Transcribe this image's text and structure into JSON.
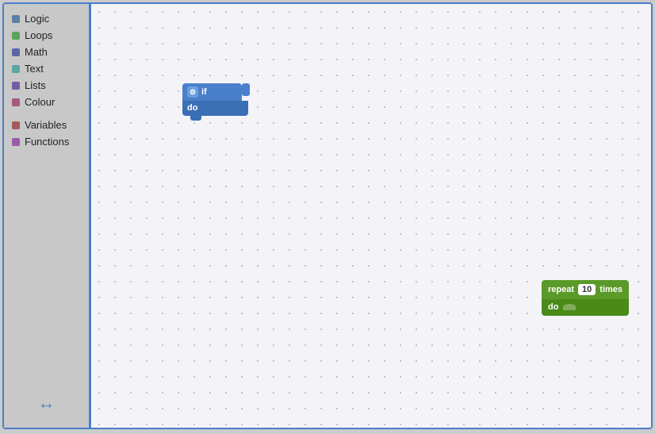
{
  "sidebar": {
    "items": [
      {
        "id": "logic",
        "label": "Logic",
        "color": "#5b80a5"
      },
      {
        "id": "loops",
        "label": "Loops",
        "color": "#5ba55b"
      },
      {
        "id": "math",
        "label": "Math",
        "color": "#5b67a5"
      },
      {
        "id": "text",
        "label": "Text",
        "color": "#5ba5a5"
      },
      {
        "id": "lists",
        "label": "Lists",
        "color": "#745ba5"
      },
      {
        "id": "colour",
        "label": "Colour",
        "color": "#a55b80"
      },
      {
        "id": "variables",
        "label": "Variables",
        "color": "#a55b5b"
      },
      {
        "id": "functions",
        "label": "Functions",
        "color": "#995ba5"
      }
    ],
    "resize_icon": "↔"
  },
  "if_block": {
    "label_if": "if",
    "label_do": "do",
    "gear_symbol": "⚙"
  },
  "repeat_block": {
    "label_repeat": "repeat",
    "label_times": "times",
    "label_do": "do",
    "value": "10"
  }
}
